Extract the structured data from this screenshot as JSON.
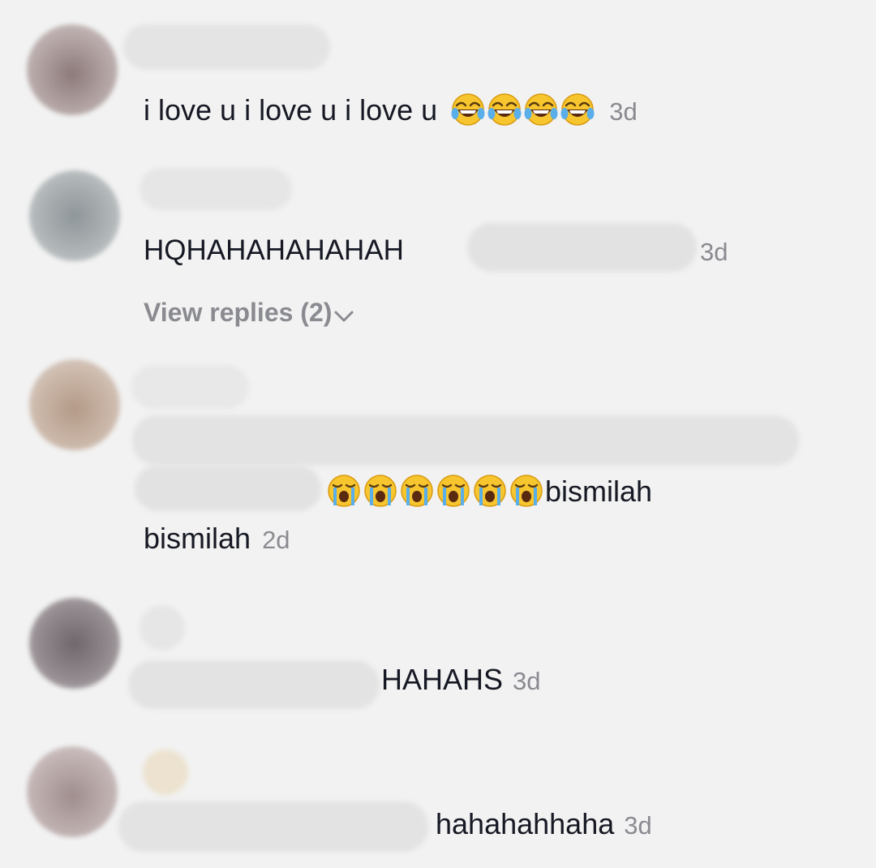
{
  "colors": {
    "background": "#f2f2f2",
    "text": "#161823",
    "secondary_text": "#8a8b91",
    "blur_placeholder": "#e3e3e3"
  },
  "comments": [
    {
      "avatar_color": "#9d8a8a",
      "body_text": "i love u i love u i love u",
      "emojis": [
        "face-with-tears-of-joy",
        "face-with-tears-of-joy",
        "face-with-tears-of-joy",
        "face-with-tears-of-joy"
      ],
      "timestamp": "3d"
    },
    {
      "avatar_color": "#a4a9ab",
      "body_text": "HQHAHAHAHAHAH",
      "timestamp": "3d",
      "view_replies_label": "View replies (2)"
    },
    {
      "avatar_color": "#c8b4a4",
      "emojis": [
        "loudly-crying-face",
        "loudly-crying-face",
        "loudly-crying-face",
        "loudly-crying-face",
        "loudly-crying-face",
        "loudly-crying-face"
      ],
      "line1_text": "bismilah",
      "line2_text": "bismilah",
      "timestamp": "2d"
    },
    {
      "avatar_color": "#8c8588",
      "body_text": "HAHAHS",
      "timestamp": "3d"
    },
    {
      "avatar_color": "#b4a3a3",
      "body_text": "hahahahhaha",
      "timestamp": "3d"
    }
  ]
}
